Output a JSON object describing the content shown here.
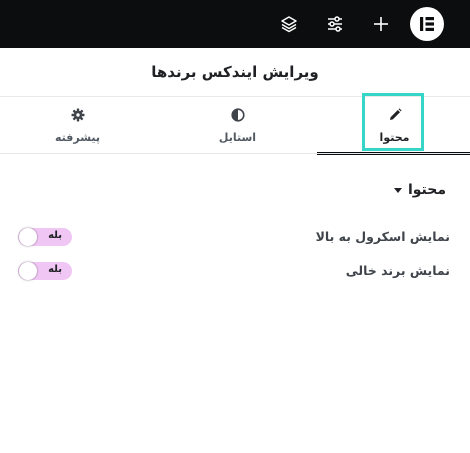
{
  "header": {
    "title": "ویرایش ایندکس برندها"
  },
  "topbar": {
    "icons": [
      "layers-icon",
      "sliders-icon",
      "plus-icon",
      "elementor-logo"
    ]
  },
  "tabs": [
    {
      "label": "محتوا",
      "icon": "pencil-icon",
      "active": true
    },
    {
      "label": "استایل",
      "icon": "half-circle-icon",
      "active": false
    },
    {
      "label": "پیشرفته",
      "icon": "gear-icon",
      "active": false
    }
  ],
  "section": {
    "title": "محتوا"
  },
  "controls": [
    {
      "label": "نمایش اسکرول به بالا",
      "switch_text": "بله"
    },
    {
      "label": "نمایش برند خالی",
      "switch_text": "بله"
    }
  ],
  "colors": {
    "topbar": "#0c0d0e",
    "switch_on": "#f0c6f4",
    "highlight": "#35d6c7"
  }
}
